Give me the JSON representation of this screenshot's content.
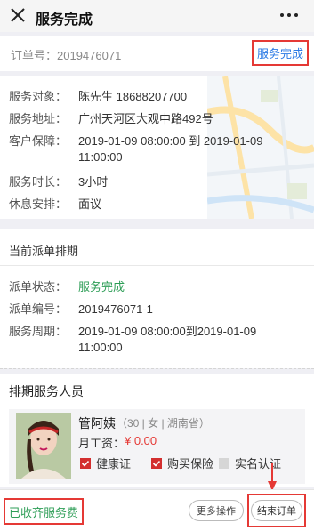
{
  "colors": {
    "accent_blue": "#2c7be5",
    "accent_green": "#2e9e57",
    "annotation_red": "#e53935",
    "price_red": "#e53935"
  },
  "header": {
    "title": "服务完成",
    "close_icon": "close-icon",
    "more_icon": "more-dots-icon"
  },
  "order": {
    "order_no": "订单号：2019476071",
    "status": "服务完成"
  },
  "info": {
    "rows": [
      {
        "label": "服务对象：",
        "value": "陈先生  18688207700"
      },
      {
        "label": "服务地址：",
        "value": "广州天河区大观中路492号"
      },
      {
        "label": "客户保障：",
        "value": "2019-01-09 08:00:00 到 2019-01-09 11:00:00"
      },
      {
        "label": "服务时长：",
        "value": "3小时"
      },
      {
        "label": "休息安排：",
        "value": "面议"
      }
    ]
  },
  "schedule": {
    "heading": "当前派单排期",
    "rows": [
      {
        "label": "派单状态：",
        "value": "服务完成"
      },
      {
        "label": "派单编号：",
        "value": "2019476071-1"
      },
      {
        "label": "服务周期：",
        "value": "2019-01-09 08:00:00到2019-01-09 11:00:00"
      }
    ]
  },
  "staff": {
    "heading": "排期服务人员",
    "name": "管阿姨",
    "meta": "（30 | 女 | 湖南省）",
    "wage_label": "月工资：",
    "wage_value": "¥ 0.00",
    "checks": [
      {
        "label": "健康证",
        "checked": true
      },
      {
        "label": "购买保险",
        "checked": true
      },
      {
        "label": "实名认证",
        "checked": false
      }
    ]
  },
  "bottom": {
    "collected": "已收齐服务费",
    "more_button": "更多操作",
    "end_button": "结束订单"
  }
}
